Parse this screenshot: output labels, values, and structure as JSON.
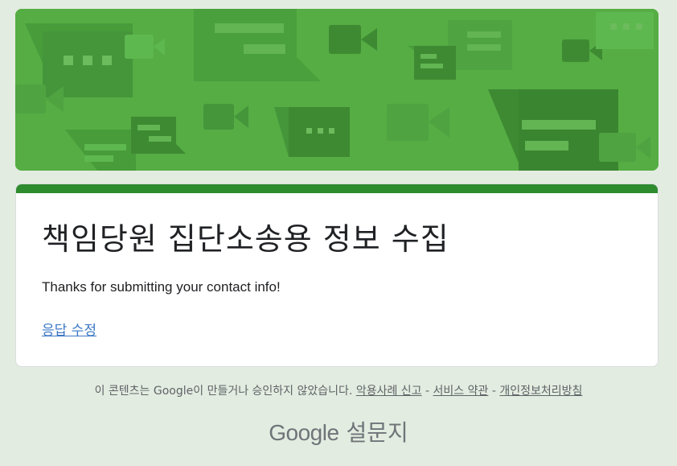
{
  "colors": {
    "page_background": "#e3ece0",
    "banner_green": "#55ad44",
    "accent_bar": "#2e8b2e",
    "link_blue": "#3b78c4"
  },
  "header": {
    "banner_icons": [
      "chat-bubble-icon",
      "video-camera-icon",
      "message-icon"
    ]
  },
  "form": {
    "title": "책임당원 집단소송용 정보 수집",
    "confirmation_message": "Thanks for submitting your contact info!",
    "edit_response_link": "응답 수정"
  },
  "footer": {
    "disclaimer": "이 콘텐츠는 Google이 만들거나 승인하지 않았습니다.",
    "report_abuse": "악용사례 신고",
    "separator": "-",
    "terms": "서비스 약관",
    "privacy": "개인정보처리방침"
  },
  "brand": {
    "google": "Google",
    "product": "설문지"
  }
}
